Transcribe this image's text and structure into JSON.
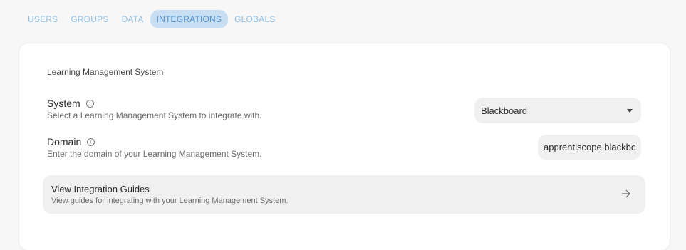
{
  "tabs": [
    {
      "label": "USERS",
      "active": false
    },
    {
      "label": "GROUPS",
      "active": false
    },
    {
      "label": "DATA",
      "active": false
    },
    {
      "label": "INTEGRATIONS",
      "active": true
    },
    {
      "label": "GLOBALS",
      "active": false
    }
  ],
  "section": {
    "title": "Learning Management System"
  },
  "system": {
    "label": "System",
    "description": "Select a Learning Management System to integrate with.",
    "selected": "Blackboard",
    "icon": "info-icon"
  },
  "domain": {
    "label": "Domain",
    "description": "Enter the domain of your Learning Management System.",
    "value": "apprentiscope.blackboard.com",
    "icon": "info-icon"
  },
  "guides": {
    "title": "View Integration Guides",
    "description": "View guides for integrating with your Learning Management System.",
    "icon": "arrow-right-icon"
  },
  "colors": {
    "accent": "#4c8fce",
    "tab_text": "#8fc0e6",
    "active_tab_bg": "#c7def3"
  }
}
